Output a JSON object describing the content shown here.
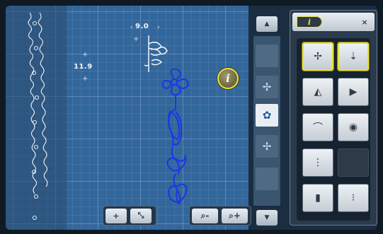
{
  "canvas": {
    "width_label": "9.0",
    "height_label": "11.9"
  },
  "info_button": {
    "label": "i",
    "icon": "info-icon"
  },
  "move_controls": {
    "buttons": [
      {
        "label": "+",
        "icon": "move-center-icon"
      },
      {
        "label": "⤡",
        "icon": "resize-arrows-icon"
      }
    ]
  },
  "zoom_controls": {
    "buttons": [
      {
        "label": "⌕-",
        "icon": "zoom-out-icon"
      },
      {
        "label": "⌕+",
        "icon": "zoom-in-icon"
      }
    ]
  },
  "scroll": {
    "up_label": "▲",
    "down_label": "▼",
    "slots": [
      {
        "label": "",
        "icon": "faded-motif-icon"
      },
      {
        "label": "✢",
        "icon": "cross-center-icon"
      },
      {
        "label": "✿",
        "icon": "flower-motif-icon"
      },
      {
        "label": "✢",
        "icon": "cross-center-icon"
      },
      {
        "label": "",
        "icon": "faded-motif-icon"
      }
    ]
  },
  "panel": {
    "tab_label": "i",
    "close_label": "×",
    "tools": [
      {
        "label": "✢",
        "icon": "move-icon"
      },
      {
        "label": "⇣",
        "icon": "align-vertical-icon"
      },
      {
        "label": "◭",
        "icon": "mirror-horizontal-icon"
      },
      {
        "label": "▶",
        "icon": "mirror-vertical-icon"
      },
      {
        "label": "⌒",
        "icon": "bridge-icon"
      },
      {
        "label": "◉",
        "icon": "rotate-icon"
      },
      {
        "label": "⋮",
        "icon": "stitch-length-icon"
      },
      {
        "label": "",
        "icon": "empty-slot"
      },
      {
        "label": "▮",
        "icon": "block-icon"
      },
      {
        "label": "⁝",
        "icon": "density-icon"
      }
    ]
  }
}
